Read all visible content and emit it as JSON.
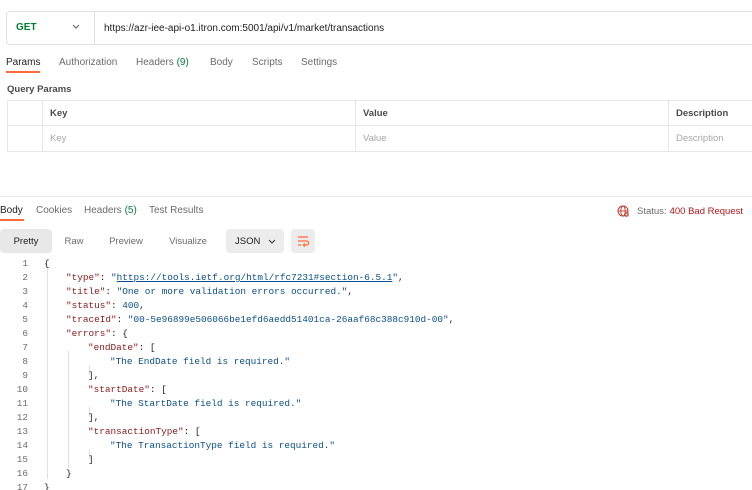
{
  "request": {
    "method": "GET",
    "url": "https://azr-iee-api-o1.itron.com:5001/api/v1/market/transactions"
  },
  "request_tabs": [
    {
      "label": "Params",
      "count": "",
      "active": true
    },
    {
      "label": "Authorization",
      "count": "",
      "active": false
    },
    {
      "label": "Headers",
      "count": "(9)",
      "active": false
    },
    {
      "label": "Body",
      "count": "",
      "active": false
    },
    {
      "label": "Scripts",
      "count": "",
      "active": false
    },
    {
      "label": "Settings",
      "count": "",
      "active": false
    }
  ],
  "query_params": {
    "title": "Query Params",
    "headers": {
      "key": "Key",
      "value": "Value",
      "description": "Description"
    },
    "placeholders": {
      "key": "Key",
      "value": "Value",
      "description": "Description"
    }
  },
  "response_tabs": [
    {
      "label": "Body",
      "count": "",
      "active": true
    },
    {
      "label": "Cookies",
      "count": "",
      "active": false
    },
    {
      "label": "Headers",
      "count": "(5)",
      "active": false
    },
    {
      "label": "Test Results",
      "count": "",
      "active": false
    }
  ],
  "status": {
    "label": "Status:",
    "value": "400 Bad Request",
    "color": "#b4161b",
    "icon": "globe-error-icon"
  },
  "view_modes": [
    "Pretty",
    "Raw",
    "Preview",
    "Visualize"
  ],
  "format": {
    "selected": "JSON"
  },
  "code_lines": [
    {
      "n": "1",
      "tokens": [
        {
          "t": "{",
          "c": "p"
        }
      ]
    },
    {
      "n": "2",
      "tokens": [
        {
          "t": "\"type\"",
          "c": "k"
        },
        {
          "t": ": ",
          "c": "p"
        },
        {
          "t": "\"",
          "c": "s"
        },
        {
          "t": "https://tools.ietf.org/html/rfc7231#section-6.5.1",
          "c": "u"
        },
        {
          "t": "\"",
          "c": "s"
        },
        {
          "t": ",",
          "c": "p"
        }
      ]
    },
    {
      "n": "3",
      "tokens": [
        {
          "t": "\"title\"",
          "c": "k"
        },
        {
          "t": ": ",
          "c": "p"
        },
        {
          "t": "\"One or more validation errors occurred.\"",
          "c": "s"
        },
        {
          "t": ",",
          "c": "p"
        }
      ]
    },
    {
      "n": "4",
      "tokens": [
        {
          "t": "\"status\"",
          "c": "k"
        },
        {
          "t": ": ",
          "c": "p"
        },
        {
          "t": "400",
          "c": "n"
        },
        {
          "t": ",",
          "c": "p"
        }
      ]
    },
    {
      "n": "5",
      "tokens": [
        {
          "t": "\"traceId\"",
          "c": "k"
        },
        {
          "t": ": ",
          "c": "p"
        },
        {
          "t": "\"00-5e96899e506066be1efd6aedd51401ca-26aaf68c388c910d-00\"",
          "c": "s"
        },
        {
          "t": ",",
          "c": "p"
        }
      ]
    },
    {
      "n": "6",
      "tokens": [
        {
          "t": "\"errors\"",
          "c": "k"
        },
        {
          "t": ": {",
          "c": "p"
        }
      ]
    },
    {
      "n": "7",
      "tokens": [
        {
          "t": "\"endDate\"",
          "c": "k"
        },
        {
          "t": ": [",
          "c": "p"
        }
      ]
    },
    {
      "n": "8",
      "tokens": [
        {
          "t": "\"The EndDate field is required.\"",
          "c": "s"
        }
      ]
    },
    {
      "n": "9",
      "tokens": [
        {
          "t": "],",
          "c": "p"
        }
      ]
    },
    {
      "n": "10",
      "tokens": [
        {
          "t": "\"startDate\"",
          "c": "k"
        },
        {
          "t": ": [",
          "c": "p"
        }
      ]
    },
    {
      "n": "11",
      "tokens": [
        {
          "t": "\"The StartDate field is required.\"",
          "c": "s"
        }
      ]
    },
    {
      "n": "12",
      "tokens": [
        {
          "t": "],",
          "c": "p"
        }
      ]
    },
    {
      "n": "13",
      "tokens": [
        {
          "t": "\"transactionType\"",
          "c": "k"
        },
        {
          "t": ": [",
          "c": "p"
        }
      ]
    },
    {
      "n": "14",
      "tokens": [
        {
          "t": "\"The TransactionType field is required.\"",
          "c": "s"
        }
      ]
    },
    {
      "n": "15",
      "tokens": [
        {
          "t": "]",
          "c": "p"
        }
      ]
    },
    {
      "n": "16",
      "tokens": [
        {
          "t": "}",
          "c": "p"
        }
      ]
    },
    {
      "n": "17",
      "tokens": [
        {
          "t": "}",
          "c": "p"
        }
      ]
    }
  ]
}
